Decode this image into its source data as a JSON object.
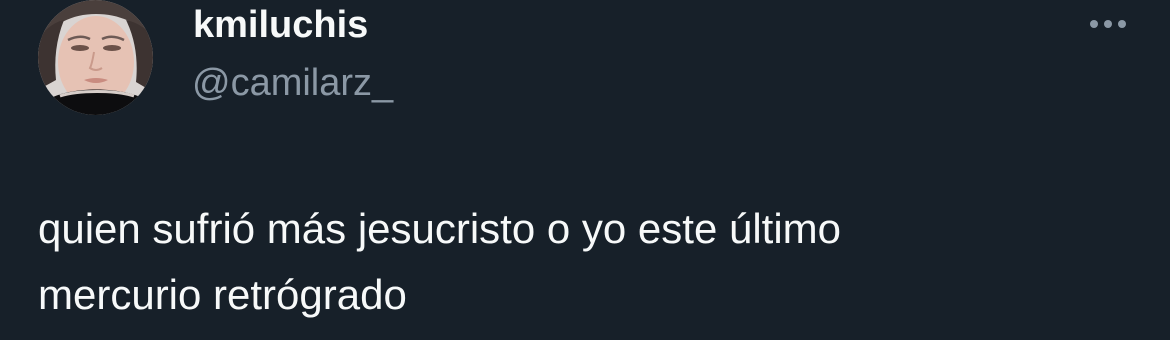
{
  "tweet": {
    "display_name": "kmiluchis",
    "handle": "@camilarz_",
    "text_lines": [
      "quien sufrió más jesucristo o yo este último",
      "mercurio retrógrado"
    ],
    "more_icon": "more-horizontal-icon"
  },
  "colors": {
    "background": "#172029",
    "primary_text": "#f7f9f9",
    "secondary_text": "#8b98a5"
  }
}
